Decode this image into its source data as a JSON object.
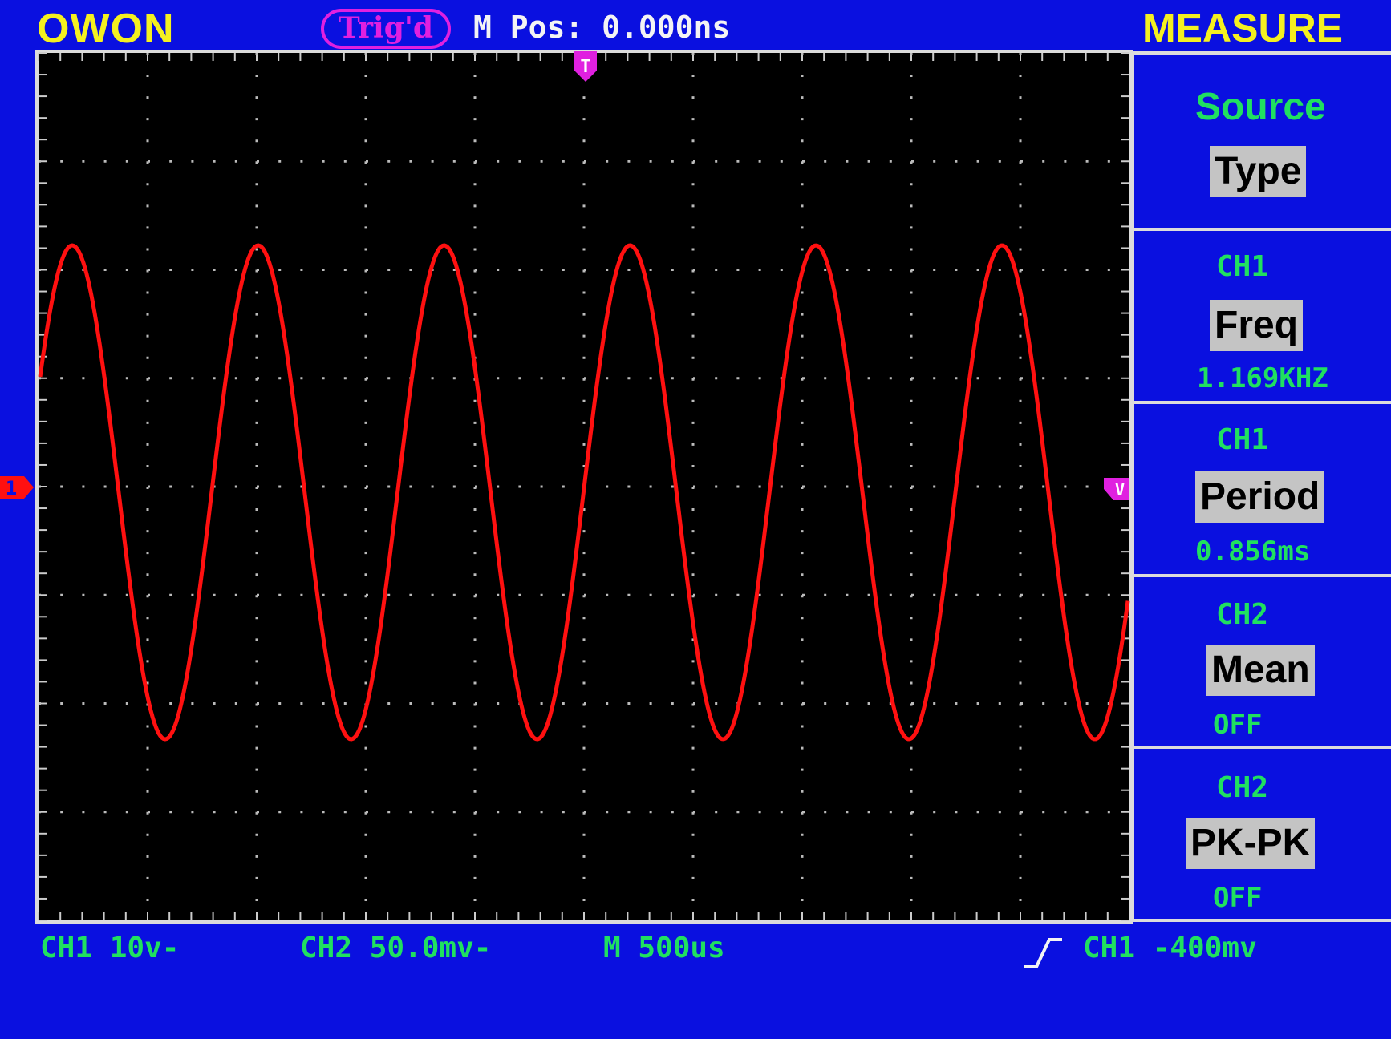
{
  "header": {
    "brand": "OWON",
    "trigger_status": "Trig'd",
    "m_pos": "M Pos: 0.000ns",
    "menu_title": "MEASURE"
  },
  "menu": {
    "source_label": "Source",
    "type_button": "Type",
    "items": [
      {
        "channel": "CH1",
        "measure": "Freq",
        "value": "1.169KHZ"
      },
      {
        "channel": "CH1",
        "measure": "Period",
        "value": "0.856ms"
      },
      {
        "channel": "CH2",
        "measure": "Mean",
        "value": "OFF"
      },
      {
        "channel": "CH2",
        "measure": "PK-PK",
        "value": "OFF"
      }
    ]
  },
  "status": {
    "ch1_scale": "CH1 10v-",
    "ch2_scale": "CH2 50.0mv-",
    "timebase": "M 500us",
    "trigger_info": "CH1 -400mv"
  },
  "markers": {
    "trigger_time": "T",
    "ch1": "1",
    "trigger_level": "V"
  },
  "colors": {
    "background": "#0a10e0",
    "trace": "#ff1010",
    "marker": "#e020e0",
    "text_green": "#20e060",
    "brand_yellow": "#f4f020"
  },
  "waveform": {
    "channel": "CH1",
    "shape": "sine",
    "cycles_on_screen": 5.85
  }
}
